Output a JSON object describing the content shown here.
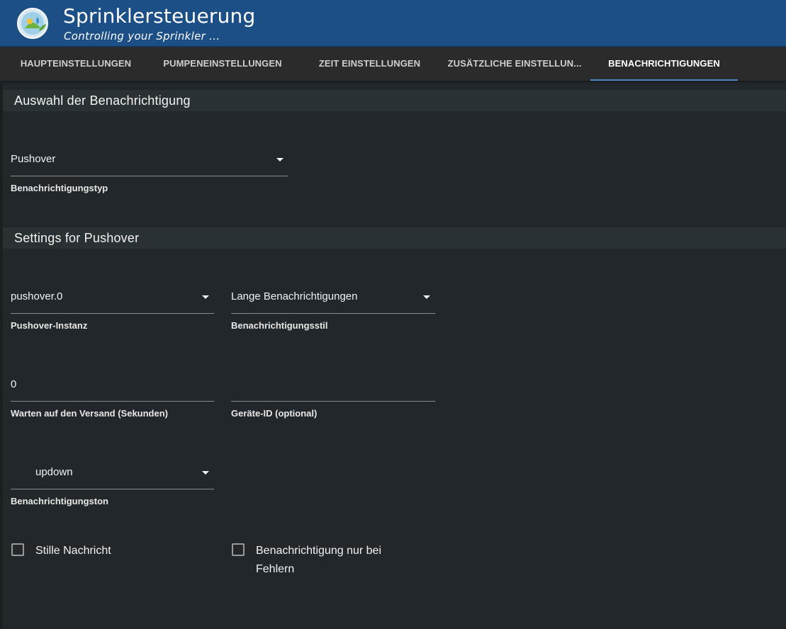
{
  "header": {
    "title": "Sprinklersteuerung",
    "subtitle": "Controlling your Sprinkler ...",
    "logo_icon": "sprinkler-logo-icon"
  },
  "tabs": [
    {
      "label": "HAUPTEINSTELLUNGEN",
      "active": false
    },
    {
      "label": "PUMPENEINSTELLUNGEN",
      "active": false
    },
    {
      "label": "ZEIT EINSTELLUNGEN",
      "active": false
    },
    {
      "label": "ZUSÄTZLICHE EINSTELLUN...",
      "active": false
    },
    {
      "label": "BENACHRICHTIGUNGEN",
      "active": true
    }
  ],
  "colors": {
    "header_bg": "#1c4f86",
    "tab_indicator": "#4f86c6",
    "page_bg": "#21272b"
  },
  "section_selection": {
    "title": "Auswahl der Benachrichtigung",
    "notification_type": {
      "value": "Pushover",
      "label": "Benachrichtigungstyp"
    }
  },
  "section_pushover": {
    "title": "Settings for Pushover",
    "instance": {
      "value": "pushover.0",
      "label": "Pushover-Instanz"
    },
    "style": {
      "value": "Lange Benachrichtigungen",
      "label": "Benachrichtigungsstil"
    },
    "delay": {
      "value": "0",
      "label": "Warten auf den Versand (Sekunden)"
    },
    "device_id": {
      "value": "",
      "label": "Geräte-ID (optional)"
    },
    "sound": {
      "value": "updown",
      "label": "Benachrichtigungston"
    },
    "silent": {
      "label": "Stille Nachricht",
      "checked": false
    },
    "errors_only": {
      "label": "Benachrichtigung nur bei Fehlern",
      "checked": false
    }
  }
}
